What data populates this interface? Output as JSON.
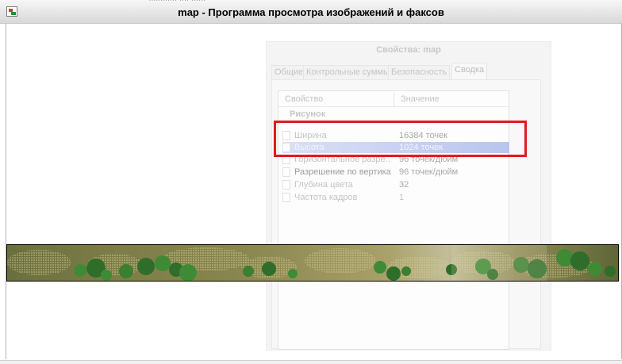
{
  "window": {
    "title": "map - Программа просмотра изображений и факсов",
    "top_fragment": "............·....·......"
  },
  "properties": {
    "title": "Свойства: map",
    "tabs": [
      "Общие",
      "Контрольные суммы",
      "Безопасность",
      "Сводка"
    ],
    "active_tab": "Сводка",
    "columns": {
      "property": "Свойство",
      "value": "Значение"
    },
    "group": "Рисунок",
    "rows": [
      {
        "name": "Ширина",
        "value": "16384 точек"
      },
      {
        "name": "Высота",
        "value": "1024 точек"
      },
      {
        "name": "Горизонтальное разре…",
        "value": "96 точек/дюйм"
      },
      {
        "name": "Разрешение по вертикали",
        "value": "96 точек/дюйм"
      },
      {
        "name": "Глубина цвета",
        "value": "32"
      },
      {
        "name": "Частота кадров",
        "value": "1"
      }
    ]
  },
  "colors": {
    "highlight_border": "#e01b1b",
    "selected_row": "#b9c5ee",
    "tree_dark": "#2f6e2a",
    "tree_mid": "#3f8b35",
    "sand": "#c9c083"
  },
  "image": {
    "description_icon": "map-strip"
  }
}
